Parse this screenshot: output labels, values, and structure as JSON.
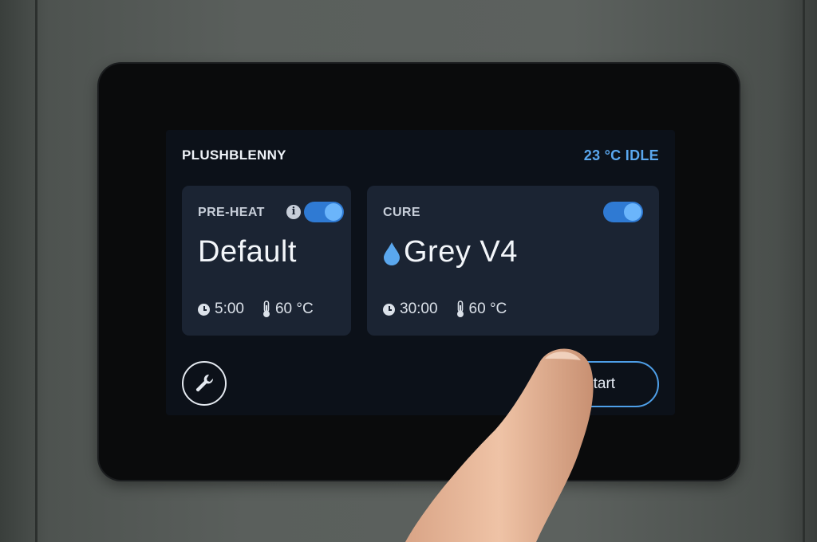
{
  "header": {
    "device_name": "PLUSHBLENNY",
    "status": "23 °C IDLE"
  },
  "preheat": {
    "label": "PRE-HEAT",
    "info_icon": "i",
    "enabled": true,
    "profile": "Default",
    "time": "5:00",
    "temperature": "60 °C"
  },
  "cure": {
    "label": "CURE",
    "enabled": true,
    "resin_icon": "droplet-icon",
    "resin": "Grey V4",
    "time": "30:00",
    "temperature": "60 °C"
  },
  "footer": {
    "settings_icon": "wrench-icon",
    "start_label": "Start"
  },
  "colors": {
    "accent": "#5aa7ee",
    "toggle_on": "#2f7ad3",
    "card_bg": "#1b2433",
    "screen_bg": "#0c1119"
  }
}
